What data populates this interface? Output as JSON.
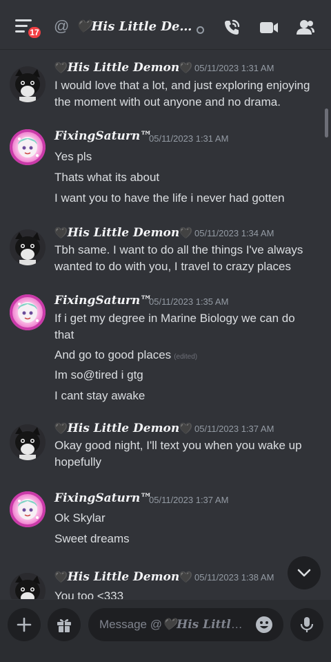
{
  "header": {
    "unread_badge": "17",
    "title": "🖤His Little Dem...",
    "at_symbol": "@"
  },
  "messages": [
    {
      "author": "His Little Demon",
      "heart": "🖤",
      "timestamp": "05/11/2023 1:31 AM",
      "avatar": "dark-cat-avatar",
      "lines": [
        "I would love that a lot, and just exploring enjoying",
        "the moment with out anyone and no drama."
      ]
    },
    {
      "author": "FixingSaturn™",
      "timestamp": "05/11/2023 1:31 AM",
      "avatar": "pink-anime-avatar",
      "lines": [
        "Yes pls",
        "Thats what its about",
        "I want you to have the life i never had gotten"
      ]
    },
    {
      "author": "His Little Demon",
      "heart": "🖤",
      "timestamp": "05/11/2023 1:34 AM",
      "avatar": "dark-cat-avatar",
      "lines": [
        "Tbh same. I want to do all the things I've always",
        "wanted to do with you, I travel to crazy places"
      ]
    },
    {
      "author": "FixingSaturn™",
      "timestamp": "05/11/2023 1:35 AM",
      "avatar": "pink-anime-avatar",
      "lines": [
        "If i get my degree in Marine Biology we can do",
        "that",
        "And go to good places",
        "Im so@tired i gtg",
        "I cant stay awake"
      ],
      "edited": "(edited)"
    },
    {
      "author": "His Little Demon",
      "heart": "🖤",
      "timestamp": "05/11/2023 1:37 AM",
      "avatar": "dark-cat-avatar",
      "lines": [
        "Okay good night, I'll text you when you wake up",
        "hopefully"
      ]
    },
    {
      "author": "FixingSaturn™",
      "timestamp": "05/11/2023 1:37 AM",
      "avatar": "pink-anime-avatar",
      "lines": [
        "Ok Skylar",
        "Sweet dreams"
      ]
    },
    {
      "author": "His Little Demon",
      "heart": "🖤",
      "timestamp": "05/11/2023 1:38 AM",
      "avatar": "dark-cat-avatar",
      "lines": [
        "You too <333"
      ]
    }
  ],
  "composer": {
    "placeholder_prefix": "Message @",
    "placeholder_name": "🖤His Little..."
  },
  "icons": {
    "menu": "hamburger-menu-icon",
    "call": "phone-call-icon",
    "video": "video-camera-icon",
    "members": "members-icon",
    "add": "plus-icon",
    "gift": "gift-icon",
    "emoji": "emoji-icon",
    "mic": "microphone-icon",
    "jump": "chevron-down-icon"
  },
  "colors": {
    "background": "#313338",
    "badge": "#f23f43",
    "text": "#dbdee1",
    "muted": "#949ba4"
  }
}
